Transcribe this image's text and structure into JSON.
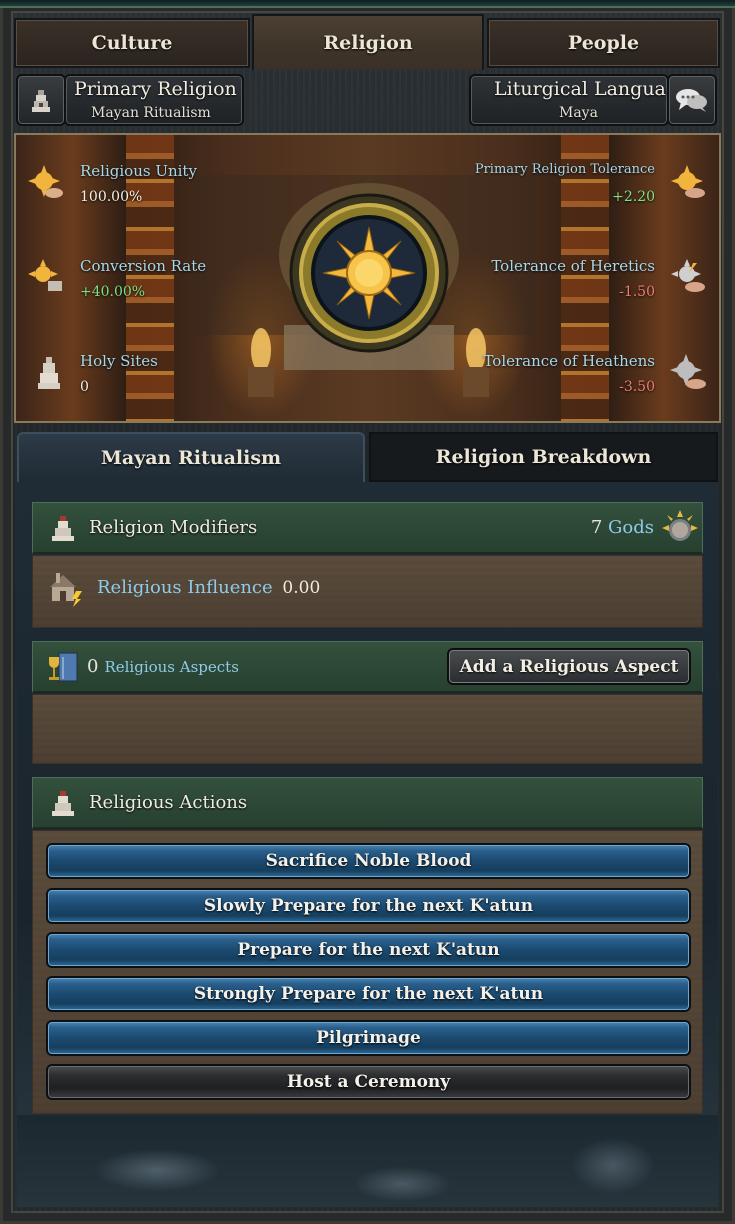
{
  "tabs": [
    {
      "label": "Culture",
      "active": false
    },
    {
      "label": "Religion",
      "active": true
    },
    {
      "label": "People",
      "active": false
    }
  ],
  "header": {
    "primary_religion_title": "Primary Religion",
    "primary_religion_value": "Mayan Ritualism",
    "liturgical_title": "Liturgical Language",
    "liturgical_value": "Maya"
  },
  "stats": {
    "religious_unity": {
      "label": "Religious Unity",
      "value": "100.00%"
    },
    "conversion_rate": {
      "label": "Conversion Rate",
      "value": "+40.00%"
    },
    "holy_sites": {
      "label": "Holy Sites",
      "value": "0"
    },
    "primary_tolerance": {
      "label": "Primary Religion Tolerance",
      "value": "+2.20"
    },
    "heretic_tolerance": {
      "label": "Tolerance of Heretics",
      "value": "-1.50"
    },
    "heathen_tolerance": {
      "label": "Tolerance of Heathens",
      "value": "-3.50"
    }
  },
  "subtabs": [
    {
      "label": "Mayan Ritualism",
      "active": true
    },
    {
      "label": "Religion Breakdown",
      "active": false
    }
  ],
  "modifiers": {
    "title": "Religion Modifiers",
    "gods_count": "7",
    "gods_label": "Gods",
    "influence_label": "Religious Influence",
    "influence_value": "0.00"
  },
  "aspects": {
    "count": "0",
    "label": "Religious Aspects",
    "button": "Add a Religious Aspect"
  },
  "actions": {
    "title": "Religious Actions",
    "items": [
      {
        "label": "Sacrifice Noble Blood",
        "style": "blue"
      },
      {
        "label": "Slowly Prepare for the next K'atun",
        "style": "blue"
      },
      {
        "label": "Prepare for the next K'atun",
        "style": "blue"
      },
      {
        "label": "Strongly Prepare for the next K'atun",
        "style": "blue"
      },
      {
        "label": "Pilgrimage",
        "style": "blue"
      },
      {
        "label": "Host a Ceremony",
        "style": "dark"
      }
    ]
  },
  "colors": {
    "positive": "#7fe07f",
    "negative": "#f07a74",
    "link": "#8ecbe8",
    "section_header": "#33513d"
  },
  "icons": {
    "primary_religion": "temple-icon",
    "liturgical": "speech-bubble-icon",
    "emblem": "sun-emblem-icon",
    "gods": "god-face-icon"
  }
}
